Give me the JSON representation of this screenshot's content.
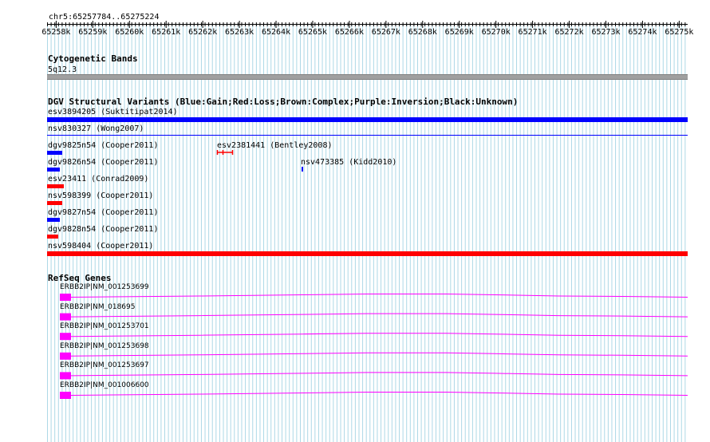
{
  "ruler": {
    "position_label": "chr5:65257784..65275224",
    "ticks": [
      "65258k",
      "65259k",
      "65260k",
      "65261k",
      "65262k",
      "65263k",
      "65264k",
      "65265k",
      "65266k",
      "65267k",
      "65268k",
      "65269k",
      "65270k",
      "65271k",
      "65272k",
      "65273k",
      "65274k",
      "65275k"
    ]
  },
  "cytobands": {
    "title": "Cytogenetic Bands",
    "band_label": "5q12.3",
    "band_color": "#a0a0a0"
  },
  "dgv": {
    "title": "DGV Structural Variants (Blue:Gain;Red:Loss;Brown:Complex;Purple:Inversion;Black:Unknown)",
    "colors": {
      "gain": "#0000ff",
      "loss": "#ff0000"
    },
    "variants": [
      {
        "label": "esv3894205 (Suktitipat2014)",
        "type": "gain"
      },
      {
        "label": "nsv830327 (Wong2007)",
        "type": "gain"
      },
      {
        "label": "dgv9825n54 (Cooper2011)",
        "type": "gain"
      },
      {
        "label": "esv2381441 (Bentley2008)",
        "type": "loss"
      },
      {
        "label": "dgv9826n54 (Cooper2011)",
        "type": "gain"
      },
      {
        "label": "nsv473385 (Kidd2010)",
        "type": "gain"
      },
      {
        "label": "esv23411 (Conrad2009)",
        "type": "loss"
      },
      {
        "label": "nsv598399 (Cooper2011)",
        "type": "loss"
      },
      {
        "label": "dgv9827n54 (Cooper2011)",
        "type": "gain"
      },
      {
        "label": "dgv9828n54 (Cooper2011)",
        "type": "loss"
      },
      {
        "label": "nsv598404 (Cooper2011)",
        "type": "loss"
      }
    ]
  },
  "refseq": {
    "title": "RefSeq Genes",
    "exon_color": "#ff00ff",
    "transcripts": [
      {
        "label": "ERBB2IP|NM_001253699"
      },
      {
        "label": "ERBB2IP|NM_018695"
      },
      {
        "label": "ERBB2IP|NM_001253701"
      },
      {
        "label": "ERBB2IP|NM_001253698"
      },
      {
        "label": "ERBB2IP|NM_001253697"
      },
      {
        "label": "ERBB2IP|NM_001006600"
      }
    ]
  }
}
